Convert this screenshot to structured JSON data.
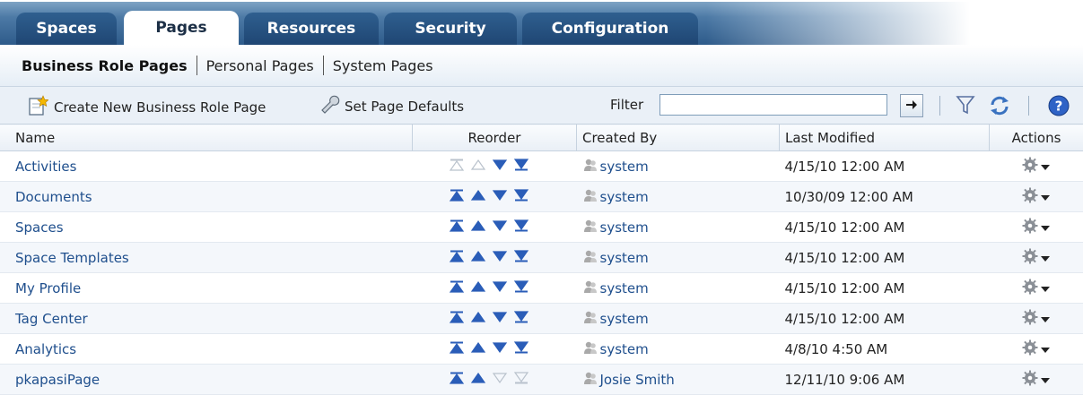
{
  "tabs": [
    {
      "label": "Spaces",
      "selected": false
    },
    {
      "label": "Pages",
      "selected": true
    },
    {
      "label": "Resources",
      "selected": false
    },
    {
      "label": "Security",
      "selected": false
    },
    {
      "label": "Configuration",
      "selected": false
    }
  ],
  "subnav": {
    "business": "Business Role Pages",
    "personal": "Personal Pages",
    "system": "System Pages"
  },
  "toolbar": {
    "create": "Create New Business Role Page",
    "defaults": "Set Page Defaults",
    "filter_label": "Filter",
    "filter_value": ""
  },
  "table": {
    "headers": {
      "name": "Name",
      "reorder": "Reorder",
      "created_by": "Created By",
      "last_modified": "Last Modified",
      "actions": "Actions"
    },
    "rows": [
      {
        "name": "Activities",
        "created_by": "system",
        "last_modified": "4/15/10 12:00 AM",
        "up_enabled": false,
        "down_enabled": true
      },
      {
        "name": "Documents",
        "created_by": "system",
        "last_modified": "10/30/09 12:00 AM",
        "up_enabled": true,
        "down_enabled": true
      },
      {
        "name": "Spaces",
        "created_by": "system",
        "last_modified": "4/15/10 12:00 AM",
        "up_enabled": true,
        "down_enabled": true
      },
      {
        "name": "Space Templates",
        "created_by": "system",
        "last_modified": "4/15/10 12:00 AM",
        "up_enabled": true,
        "down_enabled": true
      },
      {
        "name": "My Profile",
        "created_by": "system",
        "last_modified": "4/15/10 12:00 AM",
        "up_enabled": true,
        "down_enabled": true
      },
      {
        "name": "Tag Center",
        "created_by": "system",
        "last_modified": "4/15/10 12:00 AM",
        "up_enabled": true,
        "down_enabled": true
      },
      {
        "name": "Analytics",
        "created_by": "system",
        "last_modified": "4/8/10 4:50 AM",
        "up_enabled": true,
        "down_enabled": true
      },
      {
        "name": "pkapasiPage",
        "created_by": "Josie Smith",
        "last_modified": "12/11/10 9:06 AM",
        "up_enabled": true,
        "down_enabled": false
      }
    ]
  },
  "colors": {
    "link": "#1f4f8d",
    "arrow_enabled": "#2a5db8",
    "arrow_disabled": "#b9c2cc"
  }
}
